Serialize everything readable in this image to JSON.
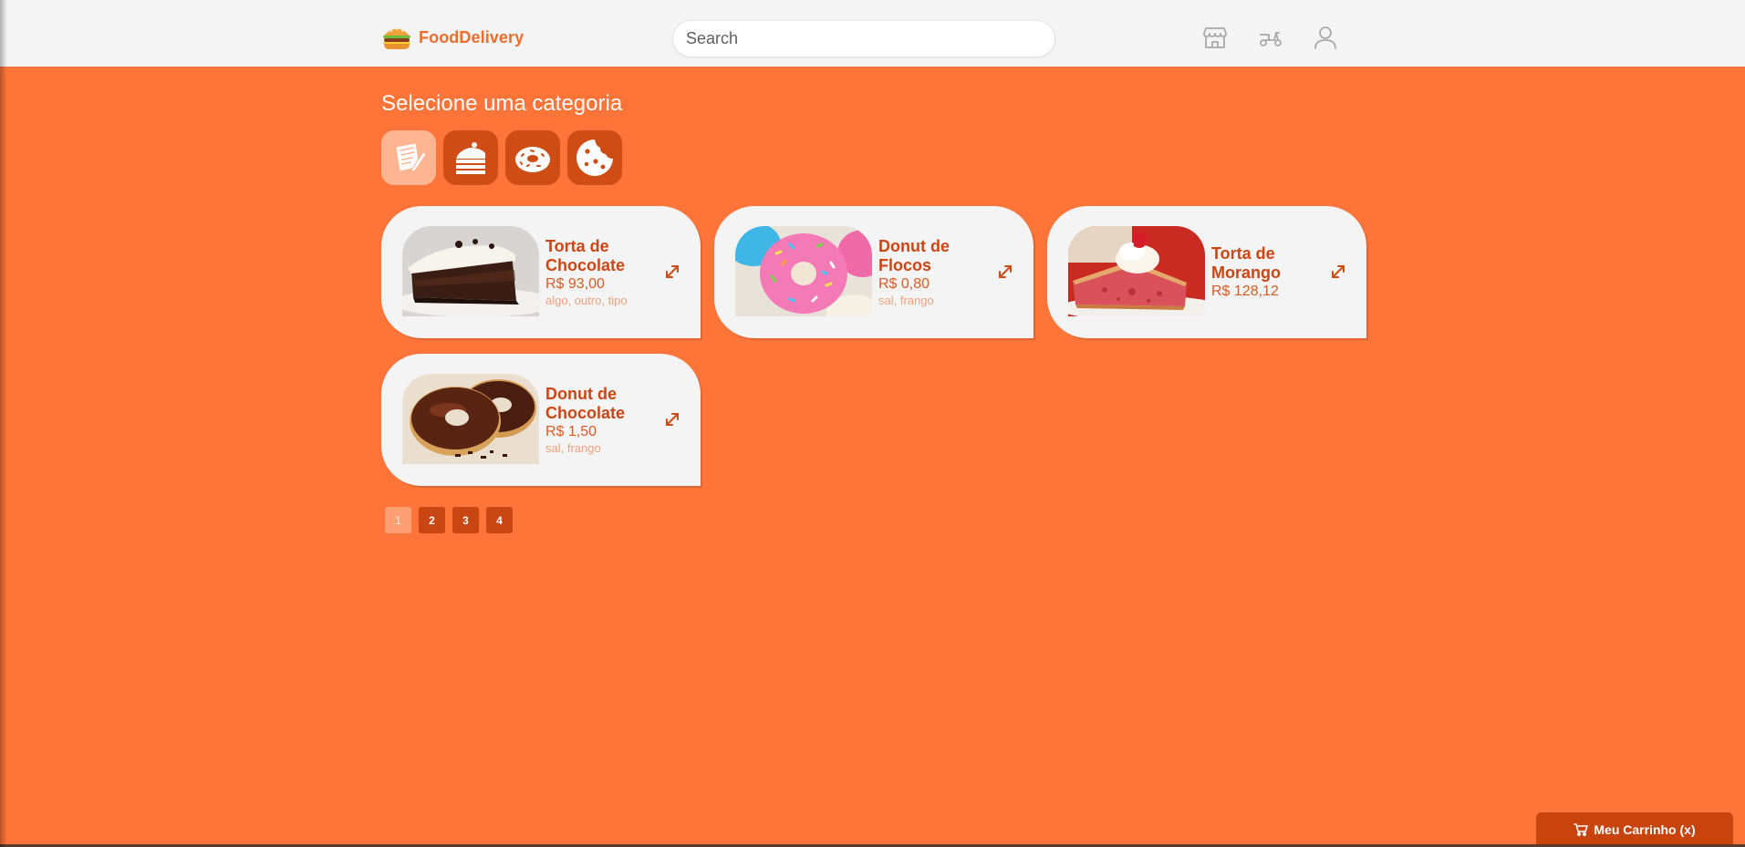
{
  "header": {
    "brand_name": "FoodDelivery",
    "search_placeholder": "Search",
    "icons": [
      "store-icon",
      "delivery-scooter-icon",
      "user-icon"
    ]
  },
  "main": {
    "title": "Selecione uma categoria",
    "categories": [
      {
        "icon": "menu-list-icon",
        "active": true
      },
      {
        "icon": "cake-slice-icon",
        "active": false
      },
      {
        "icon": "donut-icon",
        "active": false
      },
      {
        "icon": "cookie-icon",
        "active": false
      }
    ],
    "products": [
      {
        "name_line1": "Torta de",
        "name_line2": "Chocolate",
        "price": "R$ 93,00",
        "tags": "algo, outro, tipo",
        "image": "chocolate-pie-photo"
      },
      {
        "name_line1": "Donut de",
        "name_line2": "Flocos",
        "price": "R$ 0,80",
        "tags": "sal, frango",
        "image": "sprinkle-donut-photo"
      },
      {
        "name_line1": "Torta de",
        "name_line2": "Morango",
        "price": "R$ 128,12",
        "tags": "",
        "image": "strawberry-pie-photo"
      },
      {
        "name_line1": "Donut de",
        "name_line2": "Chocolate",
        "price": "R$ 1,50",
        "tags": "sal, frango",
        "image": "chocolate-donut-photo"
      }
    ],
    "pagination": [
      "1",
      "2",
      "3",
      "4"
    ],
    "current_page": "1"
  },
  "cart": {
    "label": "Meu Carrinho (x)",
    "icon": "cart-icon"
  },
  "colors": {
    "background": "#ff7438",
    "header": "#f4f4f4",
    "accent_dark": "#c9440d",
    "brand": "#f26b2a"
  }
}
